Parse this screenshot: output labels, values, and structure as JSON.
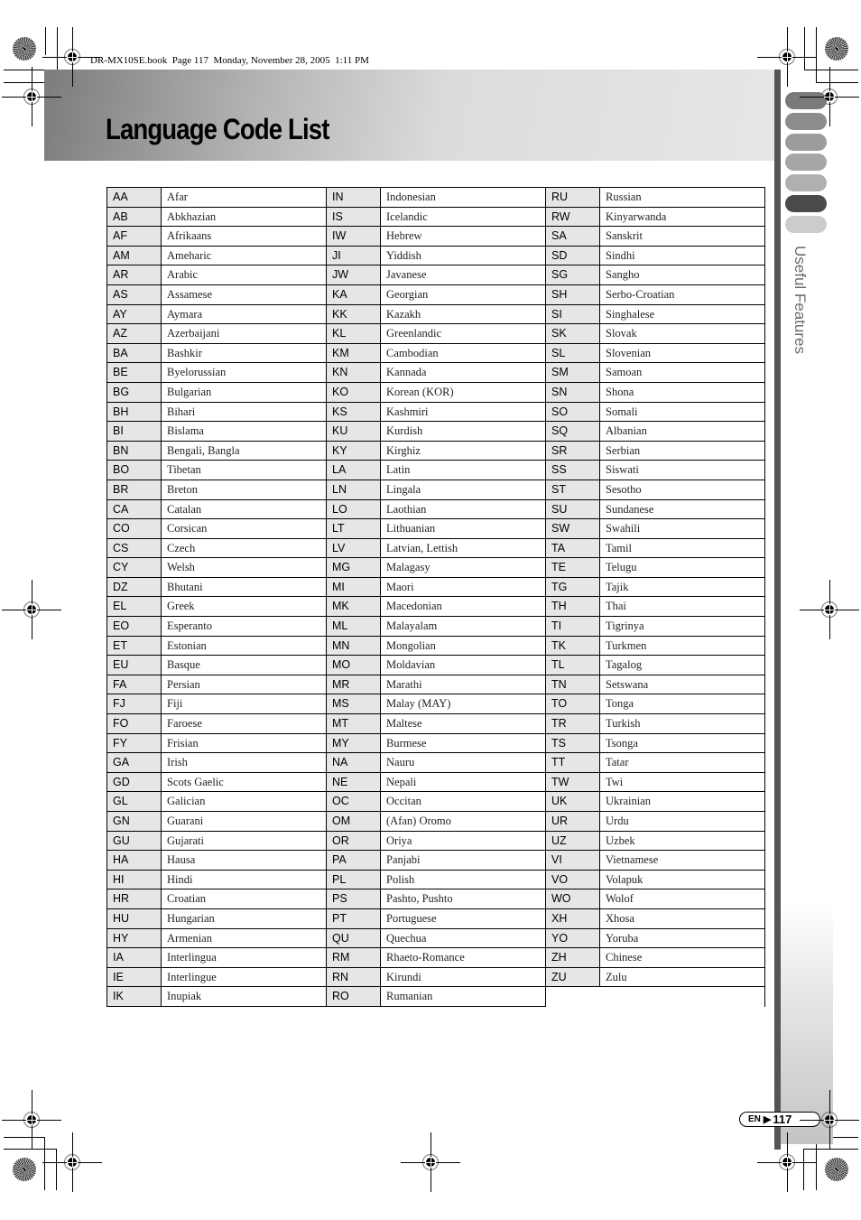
{
  "header": {
    "book_info": "DR-MX10SE.book  Page 117  Monday, November 28, 2005  1:11 PM",
    "title": "Language Code List"
  },
  "sidebar": {
    "section_label": "Useful Features",
    "tabs": [
      {
        "color": "#7a7a7a"
      },
      {
        "color": "#8c8c8c"
      },
      {
        "color": "#9c9c9c"
      },
      {
        "color": "#a6a6a6"
      },
      {
        "color": "#b0b0b0"
      },
      {
        "color": "#4a4a4a",
        "active": true
      },
      {
        "color": "#cccccc"
      }
    ]
  },
  "table": {
    "columns": [
      [
        {
          "code": "AA",
          "language": "Afar"
        },
        {
          "code": "AB",
          "language": "Abkhazian"
        },
        {
          "code": "AF",
          "language": "Afrikaans"
        },
        {
          "code": "AM",
          "language": "Ameharic"
        },
        {
          "code": "AR",
          "language": "Arabic"
        },
        {
          "code": "AS",
          "language": "Assamese"
        },
        {
          "code": "AY",
          "language": "Aymara"
        },
        {
          "code": "AZ",
          "language": "Azerbaijani"
        },
        {
          "code": "BA",
          "language": "Bashkir"
        },
        {
          "code": "BE",
          "language": "Byelorussian"
        },
        {
          "code": "BG",
          "language": "Bulgarian"
        },
        {
          "code": "BH",
          "language": "Bihari"
        },
        {
          "code": "BI",
          "language": "Bislama"
        },
        {
          "code": "BN",
          "language": "Bengali, Bangla"
        },
        {
          "code": "BO",
          "language": "Tibetan"
        },
        {
          "code": "BR",
          "language": "Breton"
        },
        {
          "code": "CA",
          "language": "Catalan"
        },
        {
          "code": "CO",
          "language": "Corsican"
        },
        {
          "code": "CS",
          "language": "Czech"
        },
        {
          "code": "CY",
          "language": "Welsh"
        },
        {
          "code": "DZ",
          "language": "Bhutani"
        },
        {
          "code": "EL",
          "language": "Greek"
        },
        {
          "code": "EO",
          "language": "Esperanto"
        },
        {
          "code": "ET",
          "language": "Estonian"
        },
        {
          "code": "EU",
          "language": "Basque"
        },
        {
          "code": "FA",
          "language": "Persian"
        },
        {
          "code": "FJ",
          "language": "Fiji"
        },
        {
          "code": "FO",
          "language": "Faroese"
        },
        {
          "code": "FY",
          "language": "Frisian"
        },
        {
          "code": "GA",
          "language": "Irish"
        },
        {
          "code": "GD",
          "language": "Scots Gaelic"
        },
        {
          "code": "GL",
          "language": "Galician"
        },
        {
          "code": "GN",
          "language": "Guarani"
        },
        {
          "code": "GU",
          "language": "Gujarati"
        },
        {
          "code": "HA",
          "language": "Hausa"
        },
        {
          "code": "HI",
          "language": "Hindi"
        },
        {
          "code": "HR",
          "language": "Croatian"
        },
        {
          "code": "HU",
          "language": "Hungarian"
        },
        {
          "code": "HY",
          "language": "Armenian"
        },
        {
          "code": "IA",
          "language": "Interlingua"
        },
        {
          "code": "IE",
          "language": "Interlingue"
        },
        {
          "code": "IK",
          "language": "Inupiak"
        }
      ],
      [
        {
          "code": "IN",
          "language": "Indonesian"
        },
        {
          "code": "IS",
          "language": "Icelandic"
        },
        {
          "code": "IW",
          "language": "Hebrew"
        },
        {
          "code": "JI",
          "language": "Yiddish"
        },
        {
          "code": "JW",
          "language": "Javanese"
        },
        {
          "code": "KA",
          "language": "Georgian"
        },
        {
          "code": "KK",
          "language": "Kazakh"
        },
        {
          "code": "KL",
          "language": "Greenlandic"
        },
        {
          "code": "KM",
          "language": "Cambodian"
        },
        {
          "code": "KN",
          "language": "Kannada"
        },
        {
          "code": "KO",
          "language": "Korean (KOR)"
        },
        {
          "code": "KS",
          "language": "Kashmiri"
        },
        {
          "code": "KU",
          "language": "Kurdish"
        },
        {
          "code": "KY",
          "language": "Kirghiz"
        },
        {
          "code": "LA",
          "language": "Latin"
        },
        {
          "code": "LN",
          "language": "Lingala"
        },
        {
          "code": "LO",
          "language": "Laothian"
        },
        {
          "code": "LT",
          "language": "Lithuanian"
        },
        {
          "code": "LV",
          "language": "Latvian, Lettish"
        },
        {
          "code": "MG",
          "language": "Malagasy"
        },
        {
          "code": "MI",
          "language": "Maori"
        },
        {
          "code": "MK",
          "language": "Macedonian"
        },
        {
          "code": "ML",
          "language": "Malayalam"
        },
        {
          "code": "MN",
          "language": "Mongolian"
        },
        {
          "code": "MO",
          "language": "Moldavian"
        },
        {
          "code": "MR",
          "language": "Marathi"
        },
        {
          "code": "MS",
          "language": "Malay (MAY)"
        },
        {
          "code": "MT",
          "language": "Maltese"
        },
        {
          "code": "MY",
          "language": "Burmese"
        },
        {
          "code": "NA",
          "language": "Nauru"
        },
        {
          "code": "NE",
          "language": "Nepali"
        },
        {
          "code": "OC",
          "language": "Occitan"
        },
        {
          "code": "OM",
          "language": "(Afan) Oromo"
        },
        {
          "code": "OR",
          "language": "Oriya"
        },
        {
          "code": "PA",
          "language": "Panjabi"
        },
        {
          "code": "PL",
          "language": "Polish"
        },
        {
          "code": "PS",
          "language": "Pashto, Pushto"
        },
        {
          "code": "PT",
          "language": "Portuguese"
        },
        {
          "code": "QU",
          "language": "Quechua"
        },
        {
          "code": "RM",
          "language": "Rhaeto-Romance"
        },
        {
          "code": "RN",
          "language": "Kirundi"
        },
        {
          "code": "RO",
          "language": "Rumanian"
        }
      ],
      [
        {
          "code": "RU",
          "language": "Russian"
        },
        {
          "code": "RW",
          "language": "Kinyarwanda"
        },
        {
          "code": "SA",
          "language": "Sanskrit"
        },
        {
          "code": "SD",
          "language": "Sindhi"
        },
        {
          "code": "SG",
          "language": "Sangho"
        },
        {
          "code": "SH",
          "language": "Serbo-Croatian"
        },
        {
          "code": "SI",
          "language": "Singhalese"
        },
        {
          "code": "SK",
          "language": "Slovak"
        },
        {
          "code": "SL",
          "language": "Slovenian"
        },
        {
          "code": "SM",
          "language": "Samoan"
        },
        {
          "code": "SN",
          "language": "Shona"
        },
        {
          "code": "SO",
          "language": "Somali"
        },
        {
          "code": "SQ",
          "language": "Albanian"
        },
        {
          "code": "SR",
          "language": "Serbian"
        },
        {
          "code": "SS",
          "language": "Siswati"
        },
        {
          "code": "ST",
          "language": "Sesotho"
        },
        {
          "code": "SU",
          "language": "Sundanese"
        },
        {
          "code": "SW",
          "language": "Swahili"
        },
        {
          "code": "TA",
          "language": "Tamil"
        },
        {
          "code": "TE",
          "language": "Telugu"
        },
        {
          "code": "TG",
          "language": "Tajik"
        },
        {
          "code": "TH",
          "language": "Thai"
        },
        {
          "code": "TI",
          "language": "Tigrinya"
        },
        {
          "code": "TK",
          "language": "Turkmen"
        },
        {
          "code": "TL",
          "language": "Tagalog"
        },
        {
          "code": "TN",
          "language": "Setswana"
        },
        {
          "code": "TO",
          "language": "Tonga"
        },
        {
          "code": "TR",
          "language": "Turkish"
        },
        {
          "code": "TS",
          "language": "Tsonga"
        },
        {
          "code": "TT",
          "language": "Tatar"
        },
        {
          "code": "TW",
          "language": "Twi"
        },
        {
          "code": "UK",
          "language": "Ukrainian"
        },
        {
          "code": "UR",
          "language": "Urdu"
        },
        {
          "code": "UZ",
          "language": "Uzbek"
        },
        {
          "code": "VI",
          "language": "Vietnamese"
        },
        {
          "code": "VO",
          "language": "Volapuk"
        },
        {
          "code": "WO",
          "language": "Wolof"
        },
        {
          "code": "XH",
          "language": "Xhosa"
        },
        {
          "code": "YO",
          "language": "Yoruba"
        },
        {
          "code": "ZH",
          "language": "Chinese"
        },
        {
          "code": "ZU",
          "language": "Zulu"
        }
      ]
    ]
  },
  "footer": {
    "lang": "EN",
    "arrow_icon": "right-triangle-icon",
    "page_number": "117"
  }
}
